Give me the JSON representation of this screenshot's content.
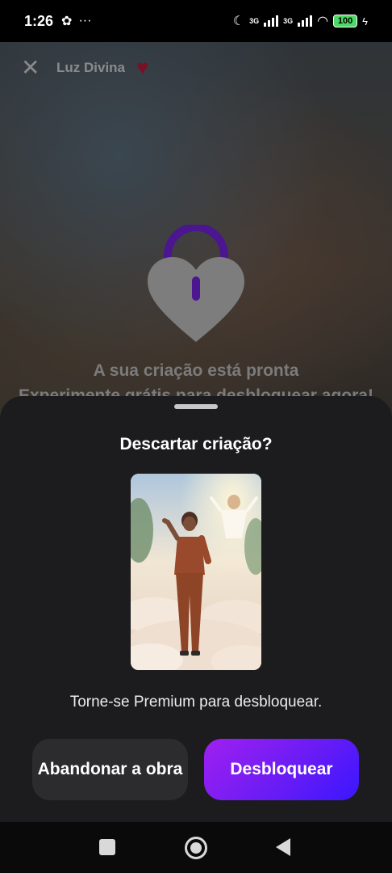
{
  "status_bar": {
    "time": "1:26",
    "left_icons": [
      "app-badge-icon",
      "more-icon"
    ],
    "network_1": "3G",
    "network_2": "3G",
    "battery": "100"
  },
  "header": {
    "title": "Luz Divina"
  },
  "locked_view": {
    "caption_line1": "A sua criação está pronta",
    "caption_line2": "Experimente grátis para desbloquear agora!"
  },
  "sheet": {
    "title": "Descartar criação?",
    "subtitle": "Torne-se Premium para desbloquear.",
    "abandon_label": "Abandonar a obra",
    "unlock_label": "Desbloquear"
  },
  "colors": {
    "unlock_gradient_start": "#a020f0",
    "unlock_gradient_end": "#3b16ff",
    "lock_shackle": "#4b1690",
    "heart_accent": "#7a1024",
    "sheet_bg": "#1c1c1e"
  }
}
